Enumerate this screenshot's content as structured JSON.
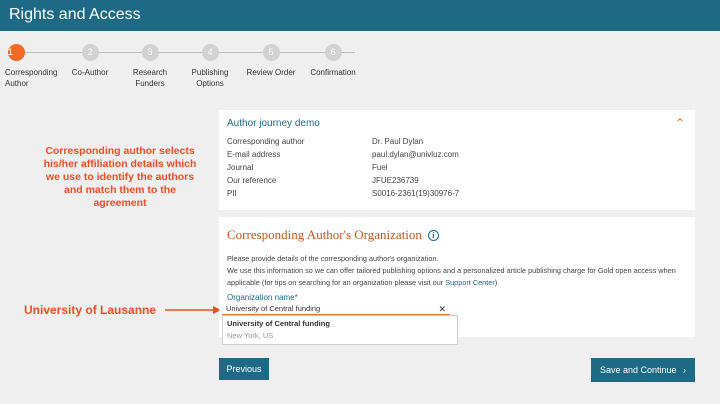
{
  "header": {
    "title": "Rights and Access"
  },
  "steps": [
    {
      "number": "1",
      "label": "Corresponding Author",
      "active": true
    },
    {
      "number": "2",
      "label": "Co-Author",
      "active": false
    },
    {
      "number": "3",
      "label": "Research Funders",
      "active": false
    },
    {
      "number": "4",
      "label": "Publishing Options",
      "active": false
    },
    {
      "number": "5",
      "label": "Review Order",
      "active": false
    },
    {
      "number": "6",
      "label": "Confirmation",
      "active": false
    }
  ],
  "journey": {
    "title": "Author journey demo",
    "rows": [
      {
        "key": "Corresponding author",
        "value": "Dr. Paul Dylan"
      },
      {
        "key": "E-mail address",
        "value": "paul.dylan@univluz.com"
      },
      {
        "key": "Journal",
        "value": "Fuel"
      },
      {
        "key": "Our reference",
        "value": "JFUE236739"
      },
      {
        "key": "PII",
        "value": "S0016-2361(19)30976-7"
      }
    ]
  },
  "organization": {
    "title": "Corresponding Author's Organization",
    "desc1": "Please provide details of the corresponding author's organization.",
    "desc2": "We use this information so we can offer tailored publishing options and a personalized article publishing charge for Gold open access when",
    "desc3": "applicable (for tips on searching for an organization please visit our ",
    "support_link": "Support Center",
    "desc3_end": ")",
    "field_label": "Organization name*",
    "field_value": "University of Central funding",
    "suggestion": {
      "name": "University of Central funding",
      "location": "New York, US"
    }
  },
  "buttons": {
    "previous": "Previous",
    "save": "Save and Continue"
  },
  "annotations": {
    "note": "Corresponding author selects his/her affiliation details which we use to identify the authors and match them to the agreement",
    "university": "University of Lausanne"
  },
  "colors": {
    "brand": "#1e6a86",
    "accent": "#f06a23",
    "annotation": "#f04c23"
  },
  "icons": {
    "info": "info-icon",
    "collapse": "chevron-up-icon",
    "clear": "close-icon",
    "next": "chevron-right-icon"
  }
}
